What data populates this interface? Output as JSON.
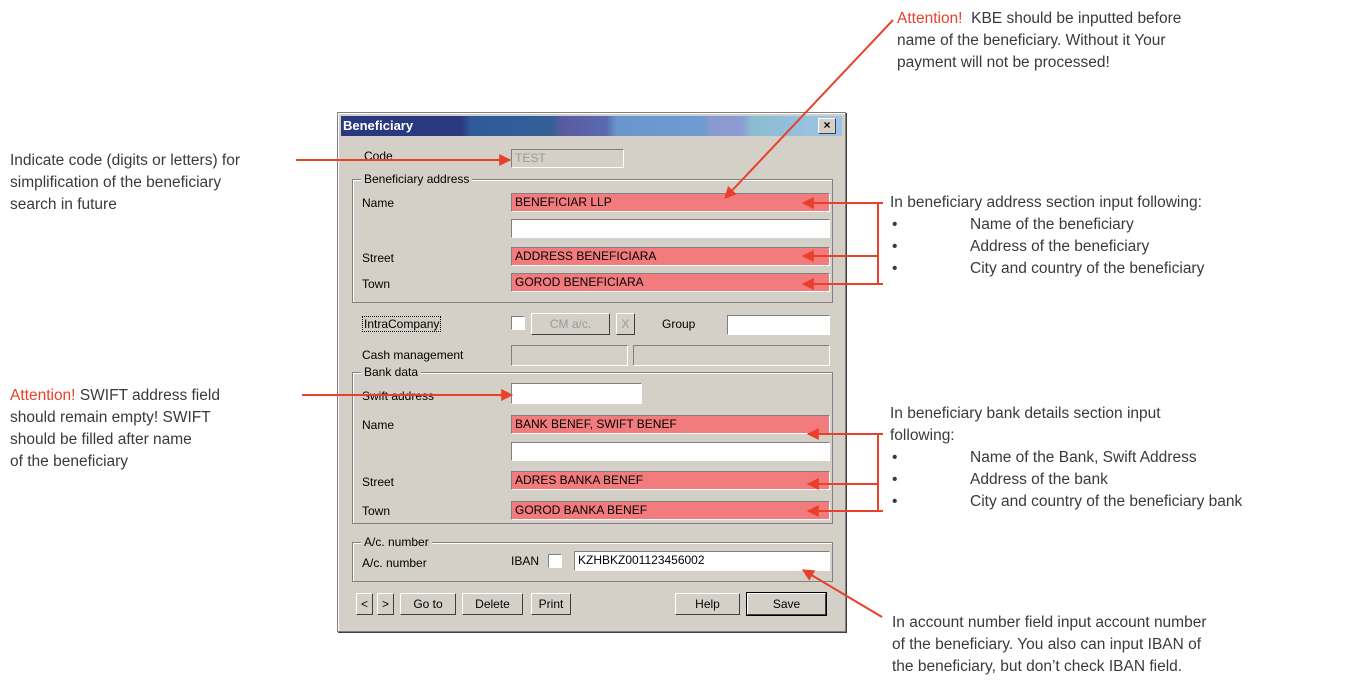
{
  "annotations": {
    "kbe_warn": "Attention!",
    "kbe_line1": "KBE should be inputted before",
    "kbe_line2": "name of the beneficiary. Without it Your",
    "kbe_line3": "payment will not be processed!",
    "code_line1": "Indicate code (digits or letters) for",
    "code_line2": "simplification of the beneficiary",
    "code_line3": "search in future",
    "swift_warn": "Attention!",
    "swift_line1": "SWIFT address field",
    "swift_line2": "should remain empty! SWIFT",
    "swift_line3": "should be filled after name",
    "swift_line4": "of the beneficiary",
    "addr_intro": "In beneficiary address section input following:",
    "addr_items": [
      "Name of the beneficiary",
      "Address of the beneficiary",
      "City and country of the beneficiary"
    ],
    "bank_intro1": "In beneficiary bank details section input",
    "bank_intro2": "following:",
    "bank_items": [
      "Name of the Bank, Swift Address",
      "Address of the bank",
      "City and country of the beneficiary bank"
    ],
    "acct_line1": "In account number field input account number",
    "acct_line2": "of the beneficiary. You also can input IBAN of",
    "acct_line3": "the beneficiary, but don’t check IBAN field."
  },
  "dialog": {
    "title": "Beneficiary",
    "close": "×",
    "code_label": "Code",
    "code_value": "TEST",
    "address_group": "Beneficiary address",
    "name_label": "Name",
    "name_value": "BENEFICIAR LLP",
    "name2_value": "",
    "street_label": "Street",
    "street_value": "ADDRESS BENEFICIARA",
    "town_label": "Town",
    "town_value": "GOROD BENEFICIARA",
    "intracompany_label": "IntraCompany",
    "cm_button": "CM a/c.",
    "x_button": "X",
    "group_label": "Group",
    "group_value": "",
    "cash_label": "Cash management",
    "bank_group": "Bank data",
    "swift_label": "Swift address",
    "swift_value": "",
    "bank_name_label": "Name",
    "bank_name_value": "BANK BENEF, SWIFT BENEF",
    "bank_name2_value": "",
    "bank_street_label": "Street",
    "bank_street_value": "ADRES BANKA BENEF",
    "bank_town_label": "Town",
    "bank_town_value": "GOROD BANKA BENEF",
    "acct_group": "A/c. number",
    "acct_label": "A/c. number",
    "iban_label": "IBAN",
    "acct_value": "KZHBKZ001123456002",
    "buttons": {
      "prev": "<",
      "next": ">",
      "goto": "Go to",
      "delete": "Delete",
      "print": "Print",
      "help": "Help",
      "save": "Save"
    }
  },
  "colors": {
    "warning": "#e8402a",
    "required_field": "#f27b7d",
    "arrow": "#e8402a"
  }
}
